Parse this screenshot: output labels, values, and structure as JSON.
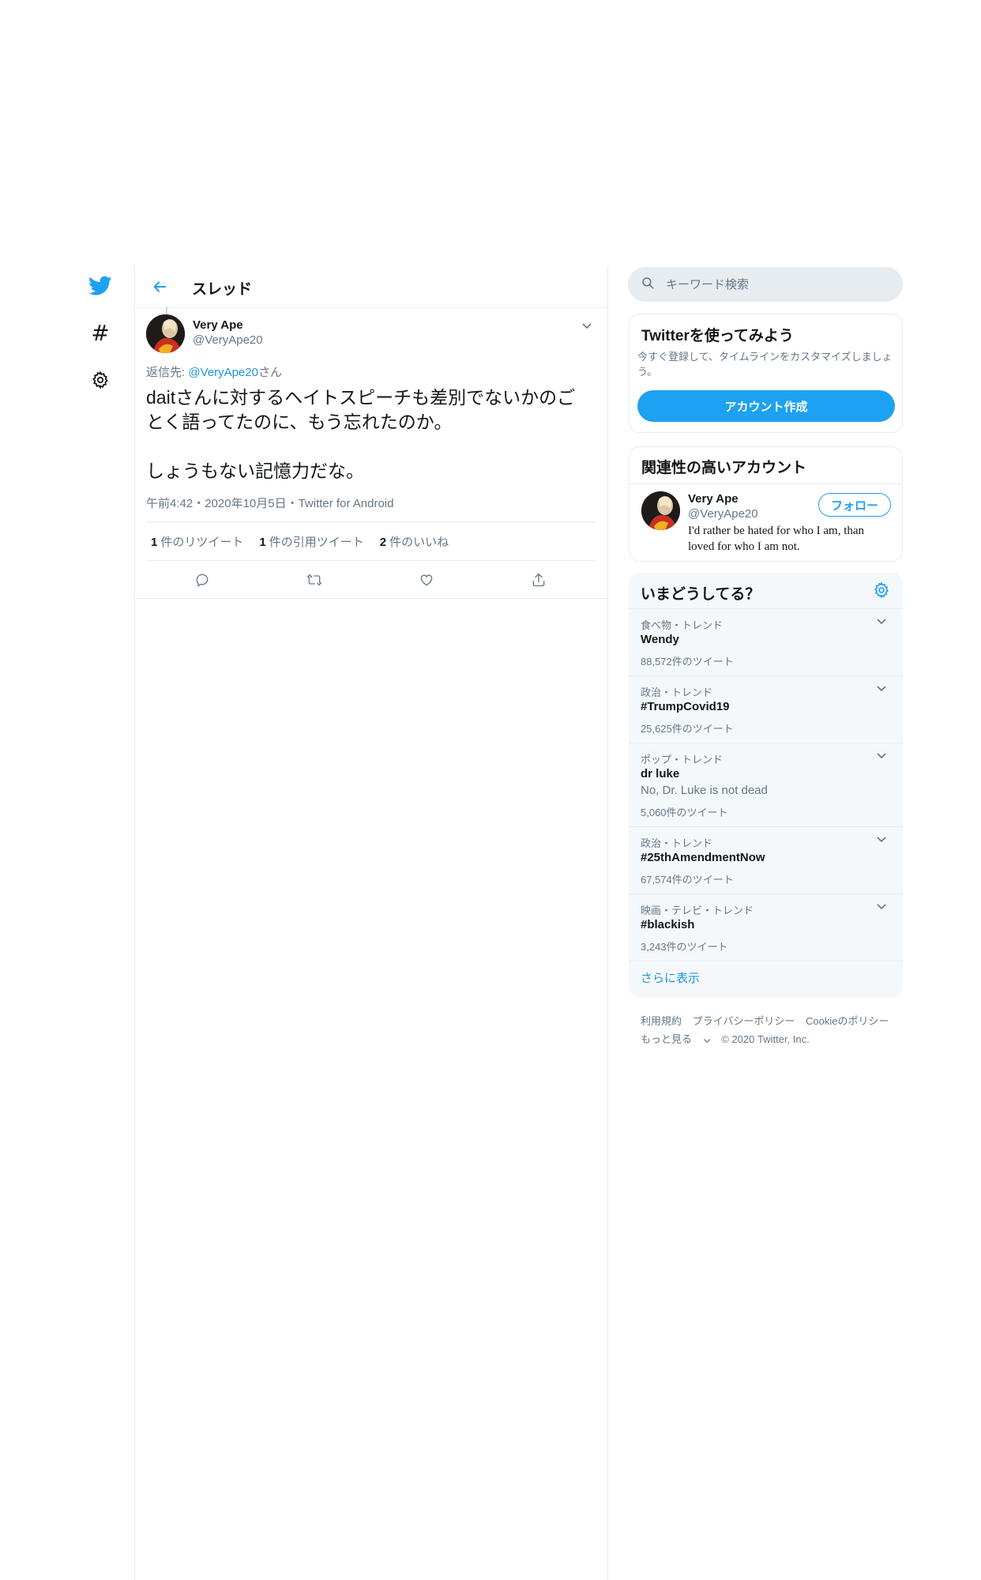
{
  "nav": {
    "items": [
      "twitter-bird-icon",
      "hashtag-icon",
      "gear-icon"
    ],
    "hashtag_glyph": "#"
  },
  "header": {
    "title": "スレッド"
  },
  "tweet": {
    "author_name": "Very Ape",
    "author_handle": "@VeryApe20",
    "reply_prefix": "返信先: ",
    "reply_mention": "@VeryApe20",
    "reply_suffix": "さん",
    "text": "daitさんに対するヘイトスピーチも差別でないかのごとく語ってたのに、もう忘れたのか。\n\nしょうもない記憶力だな。",
    "meta": "午前4:42・2020年10月5日・Twitter for Android",
    "stats": [
      {
        "count": "1",
        "label": "件のリツイート"
      },
      {
        "count": "1",
        "label": "件の引用ツイート"
      },
      {
        "count": "2",
        "label": "件のいいね"
      }
    ],
    "actions": [
      "reply-icon",
      "retweet-icon",
      "like-icon",
      "share-icon"
    ]
  },
  "search": {
    "placeholder": "キーワード検索"
  },
  "signup": {
    "title": "Twitterを使ってみよう",
    "description": "今すぐ登録して、タイムラインをカスタマイズしましょう。",
    "button": "アカウント作成"
  },
  "related": {
    "title": "関連性の高いアカウント",
    "name": "Very Ape",
    "handle": "@VeryApe20",
    "follow_label": "フォロー",
    "bio": "I'd rather be hated for who I am, than loved for who I am not."
  },
  "trends": {
    "title": "いまどうしてる？",
    "items": [
      {
        "meta": "食べ物・トレンド",
        "name": "Wendy",
        "desc": "",
        "count": "88,572件のツイート"
      },
      {
        "meta": "政治・トレンド",
        "name": "#TrumpCovid19",
        "desc": "",
        "count": "25,625件のツイート"
      },
      {
        "meta": "ポップ・トレンド",
        "name": "dr luke",
        "desc": "No, Dr. Luke is not dead",
        "count": "5,060件のツイート"
      },
      {
        "meta": "政治・トレンド",
        "name": "#25thAmendmentNow",
        "desc": "",
        "count": "67,574件のツイート"
      },
      {
        "meta": "映画・テレビ・トレンド",
        "name": "#blackish",
        "desc": "",
        "count": "3,243件のツイート"
      }
    ],
    "show_more": "さらに表示"
  },
  "footer": {
    "links": [
      "利用規約",
      "プライバシーポリシー",
      "Cookieのポリシー"
    ],
    "more": "もっと見る",
    "copyright": "© 2020 Twitter, Inc."
  },
  "colors": {
    "brand": "#1da1f2",
    "link": "#1b95e0",
    "text": "#14171a",
    "secondary": "#657786",
    "border": "#e6ecf0"
  }
}
